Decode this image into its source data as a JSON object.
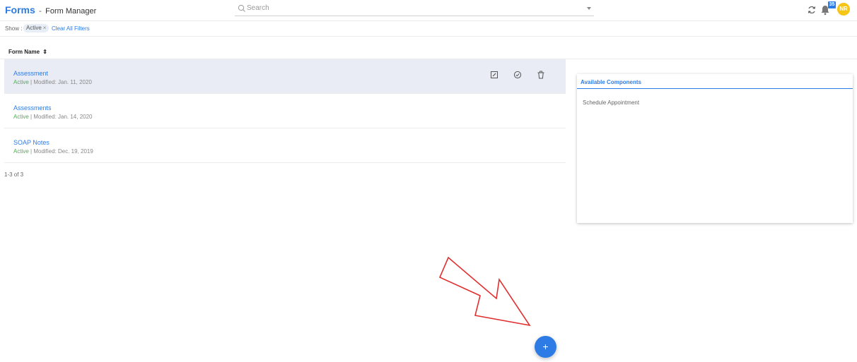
{
  "header": {
    "app_title": "Forms",
    "separator": "-",
    "subtitle": "Form Manager",
    "search_placeholder": "Search",
    "notification_count": "35",
    "avatar_initials": "NR"
  },
  "filters": {
    "show_label": "Show :",
    "active_chip": "Active",
    "chip_remove": "×",
    "clear_all": "Clear All Filters"
  },
  "table": {
    "column_header": "Form Name",
    "sort_glyph": "⇕",
    "status_separator": " | ",
    "rows": [
      {
        "name": "Assessment",
        "status": "Active",
        "modified": "Modified: Jan. 11, 2020",
        "selected": true
      },
      {
        "name": "Assessments",
        "status": "Active",
        "modified": "Modified: Jan. 14, 2020",
        "selected": false
      },
      {
        "name": "SOAP Notes",
        "status": "Active",
        "modified": "Modified: Dec. 19, 2019",
        "selected": false
      }
    ],
    "pagination": "1-3 of 3"
  },
  "row_actions": [
    "edit-icon",
    "publish-check-icon",
    "trash-icon"
  ],
  "components_panel": {
    "title": "Available Components",
    "items": [
      "Schedule Appointment"
    ]
  },
  "fab": {
    "label": "+"
  },
  "colors": {
    "accent": "#2d7be5",
    "active_status": "#4caf50",
    "selected_row": "#e9ecf5",
    "avatar": "#f5c518",
    "annotation_arrow": "#e03030"
  }
}
